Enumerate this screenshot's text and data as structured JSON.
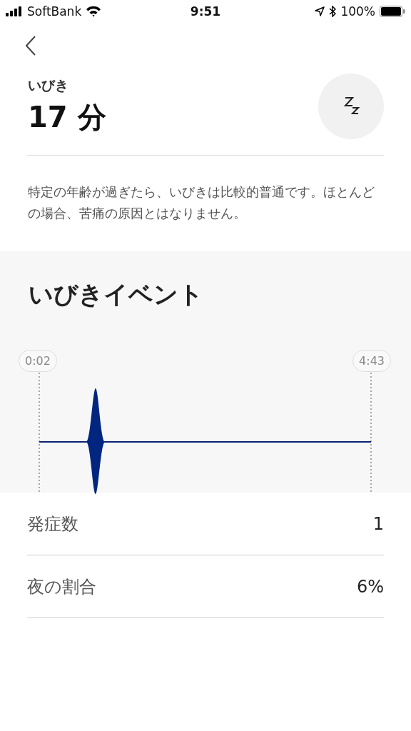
{
  "status_bar": {
    "carrier": "SoftBank",
    "time": "9:51",
    "battery": "100%"
  },
  "summary": {
    "label": "いびき",
    "value": "17 分"
  },
  "description": "特定の年齢が過ぎたら、いびきは比較的普通です。ほとんどの場合、苦痛の原因とはなりません。",
  "events": {
    "title": "いびきイベント",
    "start_time": "0:02",
    "end_time": "4:43"
  },
  "stats": [
    {
      "label": "発症数",
      "value": "1"
    },
    {
      "label": "夜の割合",
      "value": "6%"
    }
  ]
}
